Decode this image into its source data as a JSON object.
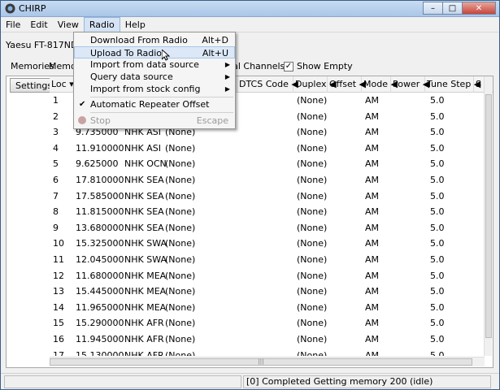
{
  "window": {
    "title": "CHIRP"
  },
  "menubar": {
    "items": [
      "File",
      "Edit",
      "View",
      "Radio",
      "Help"
    ],
    "active": "Radio"
  },
  "radio": {
    "label": "Yaesu FT-817ND:"
  },
  "tabs": {
    "memories": "Memories",
    "memories2": "Memor",
    "special": "cial Channels",
    "show_empty": "Show Empty",
    "show_empty_checked": true
  },
  "settings_label": "Settings",
  "columns": [
    "Loc",
    "DTCS Code",
    "Duplex",
    "Offset",
    "Mode",
    "Power",
    "Tune Step",
    "S"
  ],
  "rows": [
    {
      "loc": "1",
      "freq": "",
      "name": "",
      "tone": "",
      "duplex": "(None)",
      "mode": "AM",
      "step": "5.0"
    },
    {
      "loc": "2",
      "freq": "",
      "name": "",
      "tone": "",
      "duplex": "(None)",
      "mode": "AM",
      "step": "5.0"
    },
    {
      "loc": "3",
      "freq": "9.735000",
      "name": "NHK ASI",
      "tone": "(None)",
      "duplex": "(None)",
      "mode": "AM",
      "step": "5.0"
    },
    {
      "loc": "4",
      "freq": "11.910000",
      "name": "NHK ASI",
      "tone": "(None)",
      "duplex": "(None)",
      "mode": "AM",
      "step": "5.0"
    },
    {
      "loc": "5",
      "freq": "9.625000",
      "name": "NHK OCN",
      "tone": "(None)",
      "duplex": "(None)",
      "mode": "AM",
      "step": "5.0"
    },
    {
      "loc": "6",
      "freq": "17.810000",
      "name": "NHK SEA",
      "tone": "(None)",
      "duplex": "(None)",
      "mode": "AM",
      "step": "5.0"
    },
    {
      "loc": "7",
      "freq": "17.585000",
      "name": "NHK SEA",
      "tone": "(None)",
      "duplex": "(None)",
      "mode": "AM",
      "step": "5.0"
    },
    {
      "loc": "8",
      "freq": "11.815000",
      "name": "NHK SEA",
      "tone": "(None)",
      "duplex": "(None)",
      "mode": "AM",
      "step": "5.0"
    },
    {
      "loc": "9",
      "freq": "13.680000",
      "name": "NHK SEA",
      "tone": "(None)",
      "duplex": "(None)",
      "mode": "AM",
      "step": "5.0"
    },
    {
      "loc": "10",
      "freq": "15.325000",
      "name": "NHK SWA",
      "tone": "(None)",
      "duplex": "(None)",
      "mode": "AM",
      "step": "5.0"
    },
    {
      "loc": "11",
      "freq": "12.045000",
      "name": "NHK SWA",
      "tone": "(None)",
      "duplex": "(None)",
      "mode": "AM",
      "step": "5.0"
    },
    {
      "loc": "12",
      "freq": "11.680000",
      "name": "NHK MEA",
      "tone": "(None)",
      "duplex": "(None)",
      "mode": "AM",
      "step": "5.0"
    },
    {
      "loc": "13",
      "freq": "15.445000",
      "name": "NHK MEA",
      "tone": "(None)",
      "duplex": "(None)",
      "mode": "AM",
      "step": "5.0"
    },
    {
      "loc": "14",
      "freq": "11.965000",
      "name": "NHK MEA",
      "tone": "(None)",
      "duplex": "(None)",
      "mode": "AM",
      "step": "5.0"
    },
    {
      "loc": "15",
      "freq": "15.290000",
      "name": "NHK AFR",
      "tone": "(None)",
      "duplex": "(None)",
      "mode": "AM",
      "step": "5.0"
    },
    {
      "loc": "16",
      "freq": "11.945000",
      "name": "NHK AFR",
      "tone": "(None)",
      "duplex": "(None)",
      "mode": "AM",
      "step": "5.0"
    },
    {
      "loc": "17",
      "freq": "15.130000",
      "name": "NHK AFR",
      "tone": "(None)",
      "duplex": "(None)",
      "mode": "AM",
      "step": "5.0"
    }
  ],
  "dropdown": {
    "download": {
      "label": "Download From Radio",
      "shortcut": "Alt+D"
    },
    "upload": {
      "label": "Upload To Radio",
      "shortcut": "Alt+U"
    },
    "import_file": "Import from data source",
    "query": "Query data source",
    "import_stock": "Import from stock config",
    "auto_offset": "Automatic Repeater Offset",
    "stop": {
      "label": "Stop",
      "shortcut": "Escape"
    }
  },
  "status": {
    "text": "[0] Completed Getting memory 200 (idle)"
  },
  "colors": {
    "menu_hover": "#dce8f7",
    "titlebar": "#a9c6e8"
  }
}
